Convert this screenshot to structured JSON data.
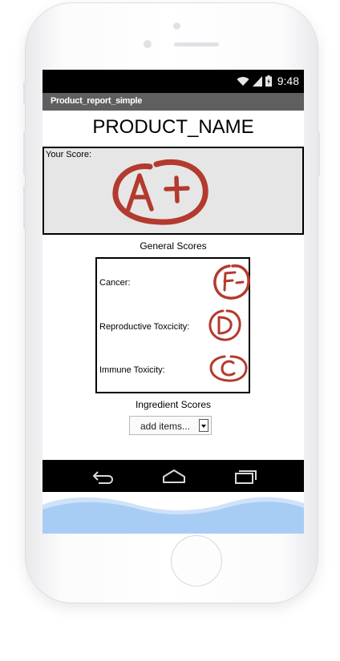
{
  "status_bar": {
    "time": "9:48"
  },
  "app_title": "Product_report_simple",
  "product_name": "PRODUCT_NAME",
  "score_section": {
    "label": "Your Score:",
    "grade": "A+"
  },
  "general_scores": {
    "title": "General Scores",
    "items": [
      {
        "label": "Cancer:",
        "grade": "F-"
      },
      {
        "label": "Reproductive Toxcicity:",
        "grade": "D"
      },
      {
        "label": "Immune Toxicity:",
        "grade": "C"
      }
    ]
  },
  "ingredient_scores": {
    "title": "Ingredient Scores",
    "select_value": "add items..."
  },
  "colors": {
    "grade_red": "#b33a2e",
    "status_bar": "#000000",
    "title_bar": "#5f5f5f",
    "wave_blue": "#9cc6f4"
  },
  "icons": [
    "wifi-icon",
    "signal-icon",
    "battery-icon",
    "back-icon",
    "home-icon",
    "recent-apps-icon"
  ]
}
